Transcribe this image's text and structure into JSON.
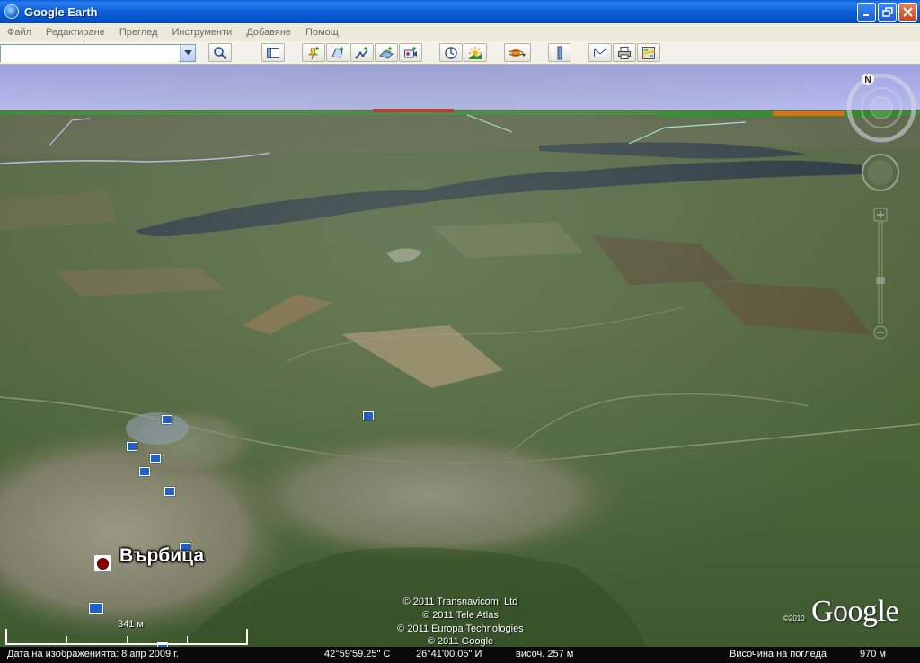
{
  "window": {
    "title": "Google Earth"
  },
  "menu": [
    "Файл",
    "Редактиране",
    "Преглед",
    "Инструменти",
    "Добавяне",
    "Помощ"
  ],
  "search": {
    "value": ""
  },
  "map": {
    "place_label": "Върбица",
    "copyright": [
      "© 2011 Transnavicom, Ltd",
      "© 2011 Tele Atlas",
      "© 2011 Europa Technologies",
      "© 2011 Google"
    ],
    "logo_year": "©2010",
    "logo": "Google",
    "scale_label": "341 м"
  },
  "status": {
    "imagery_date": "Дата на изображенията:  8 апр 2009 г.",
    "latitude": "42°59'59.25\" С",
    "longitude": "26°41'00.05\" И",
    "elevation": "височ.  257 м",
    "eye_alt_label": "Височина на погледа",
    "eye_alt_value": "970 м"
  },
  "icons": {
    "search": "magnifier-icon",
    "sidebar": "sidebar-toggle-icon",
    "placemark": "pushpin-icon",
    "polygon": "polygon-icon",
    "path": "path-icon",
    "overlay": "image-overlay-icon",
    "tour": "record-tour-icon",
    "history": "clock-icon",
    "sunlight": "sun-icon",
    "planets": "planet-icon",
    "ruler": "ruler-icon",
    "email": "envelope-icon",
    "print": "printer-icon",
    "maps": "google-maps-icon"
  }
}
